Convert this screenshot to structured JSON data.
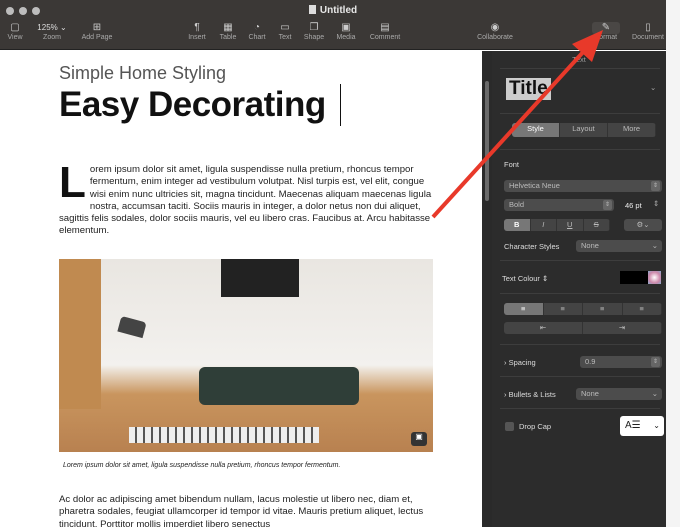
{
  "window": {
    "title": "Untitled"
  },
  "toolbar": {
    "view": "View",
    "zoom_value": "125% ⌄",
    "zoom": "Zoom",
    "add_page": "Add Page",
    "insert": "Insert",
    "table": "Table",
    "chart": "Chart",
    "text": "Text",
    "shape": "Shape",
    "media": "Media",
    "comment": "Comment",
    "collaborate": "Collaborate",
    "format": "Format",
    "document": "Document"
  },
  "doc": {
    "subtitle": "Simple Home Styling",
    "heading": "Easy Decorating",
    "dropcap": "L",
    "body1": "orem ipsum dolor sit amet, ligula suspendisse nulla pretium, rhoncus tempor fermentum, enim integer ad vestibulum volutpat. Nisl turpis est, vel elit, congue wisi enim nunc ultricies sit, magna tincidunt. Maecenas aliquam maecenas ligula nostra, accumsan taciti. Sociis mauris in integer, a dolor netus non dui aliquet, sagittis felis sodales, dolor sociis mauris, vel eu libero cras. Faucibus at. Arcu habitasse elementum.",
    "caption": "Lorem ipsum dolor sit amet, ligula suspendisse nulla pretium, rhoncus tempor fermentum.",
    "body2": "Ac dolor ac adipiscing amet bibendum nullam, lacus molestie ut libero nec, diam et, pharetra sodales, feugiat ullamcorper id tempor id vitae. Mauris pretium aliquet, lectus tincidunt. Porttitor mollis imperdiet libero senectus"
  },
  "sidebar": {
    "header": "Text",
    "style_preview": "Title",
    "tabs": [
      "Style",
      "Layout",
      "More"
    ],
    "font_label": "Font",
    "font_family": "Helvetica Neue",
    "font_weight": "Bold",
    "font_size": "46 pt",
    "format_buttons": [
      "B",
      "I",
      "U",
      "S"
    ],
    "char_styles_label": "Character Styles",
    "char_styles_value": "None",
    "text_colour_label": "Text Colour ⇕",
    "text_colour": "#000000",
    "spacing_label": "Spacing",
    "spacing_value": "0.9",
    "bullets_label": "Bullets & Lists",
    "bullets_value": "None",
    "dropcap_label": "Drop Cap"
  },
  "annotation": {
    "arrow_color": "#e8392a"
  }
}
